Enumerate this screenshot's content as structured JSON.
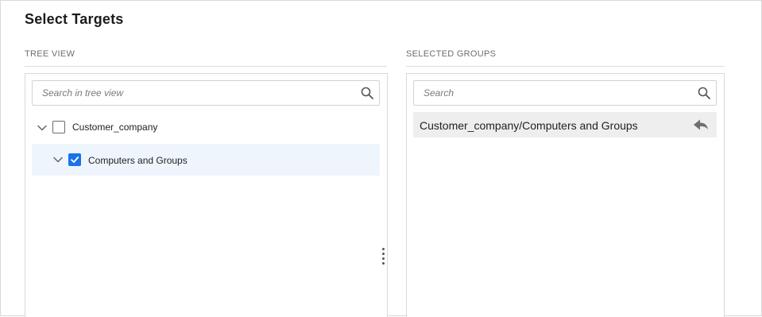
{
  "dialog": {
    "title": "Select Targets"
  },
  "tree_view": {
    "section_label": "TREE VIEW",
    "search": {
      "placeholder": "Search in tree view",
      "value": "",
      "icon": "search-icon"
    },
    "nodes": [
      {
        "label": "Customer_company",
        "checked": false,
        "expanded": true,
        "level": 0,
        "icon": "chevron-down-icon"
      },
      {
        "label": "Computers and Groups",
        "checked": true,
        "expanded": true,
        "level": 1,
        "highlighted": true,
        "icon": "chevron-down-icon"
      }
    ]
  },
  "selected_groups": {
    "section_label": "SELECTED GROUPS",
    "search": {
      "placeholder": "Search",
      "value": "",
      "icon": "search-icon"
    },
    "items": [
      {
        "label": "Customer_company/Computers and Groups",
        "icon": "remove-arrow-icon"
      }
    ]
  },
  "colors": {
    "accent": "#1a73e8",
    "selected_row_bg": "#eef5fd",
    "selected_item_bg": "#eeeeee"
  }
}
